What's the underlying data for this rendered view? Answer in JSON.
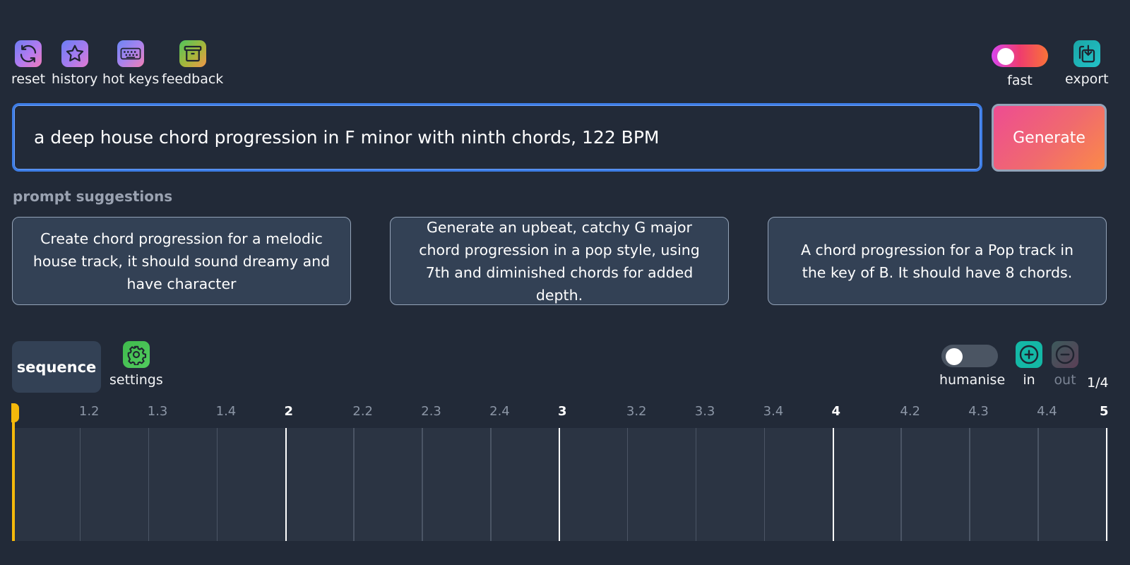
{
  "toolbar": {
    "reset": "reset",
    "history": "history",
    "hotkeys": "hot keys",
    "feedback": "feedback",
    "fast": "fast",
    "export": "export"
  },
  "prompt": {
    "value": "a deep house chord progression in F minor with ninth chords, 122 BPM",
    "generate": "Generate"
  },
  "suggestions": {
    "title": "prompt suggestions",
    "items": [
      "Create chord progression for a melodic house track, it should sound dreamy and have character",
      "Generate an upbeat, catchy G major chord progression in a pop style, using 7th and diminished chords for added depth.",
      "A chord progression for a Pop track in the key of B. It should have 8 chords."
    ]
  },
  "sequence": {
    "tab": "sequence",
    "settings": "settings",
    "humanise": "humanise",
    "zoom_in": "in",
    "zoom_out": "out",
    "grid": "1/4",
    "fast_enabled": true,
    "humanise_enabled": false
  },
  "timeline": {
    "ticks": [
      "1.2",
      "1.3",
      "1.4",
      "2",
      "2.2",
      "2.3",
      "2.4",
      "3",
      "3.2",
      "3.3",
      "3.4",
      "4",
      "4.2",
      "4.3",
      "4.4",
      "5"
    ],
    "major": [
      "2",
      "3",
      "4",
      "5"
    ]
  },
  "colors": {
    "background": "#222a38",
    "panel": "#334155",
    "accent_blue": "#3d7de6",
    "playhead": "#f5b90b"
  }
}
